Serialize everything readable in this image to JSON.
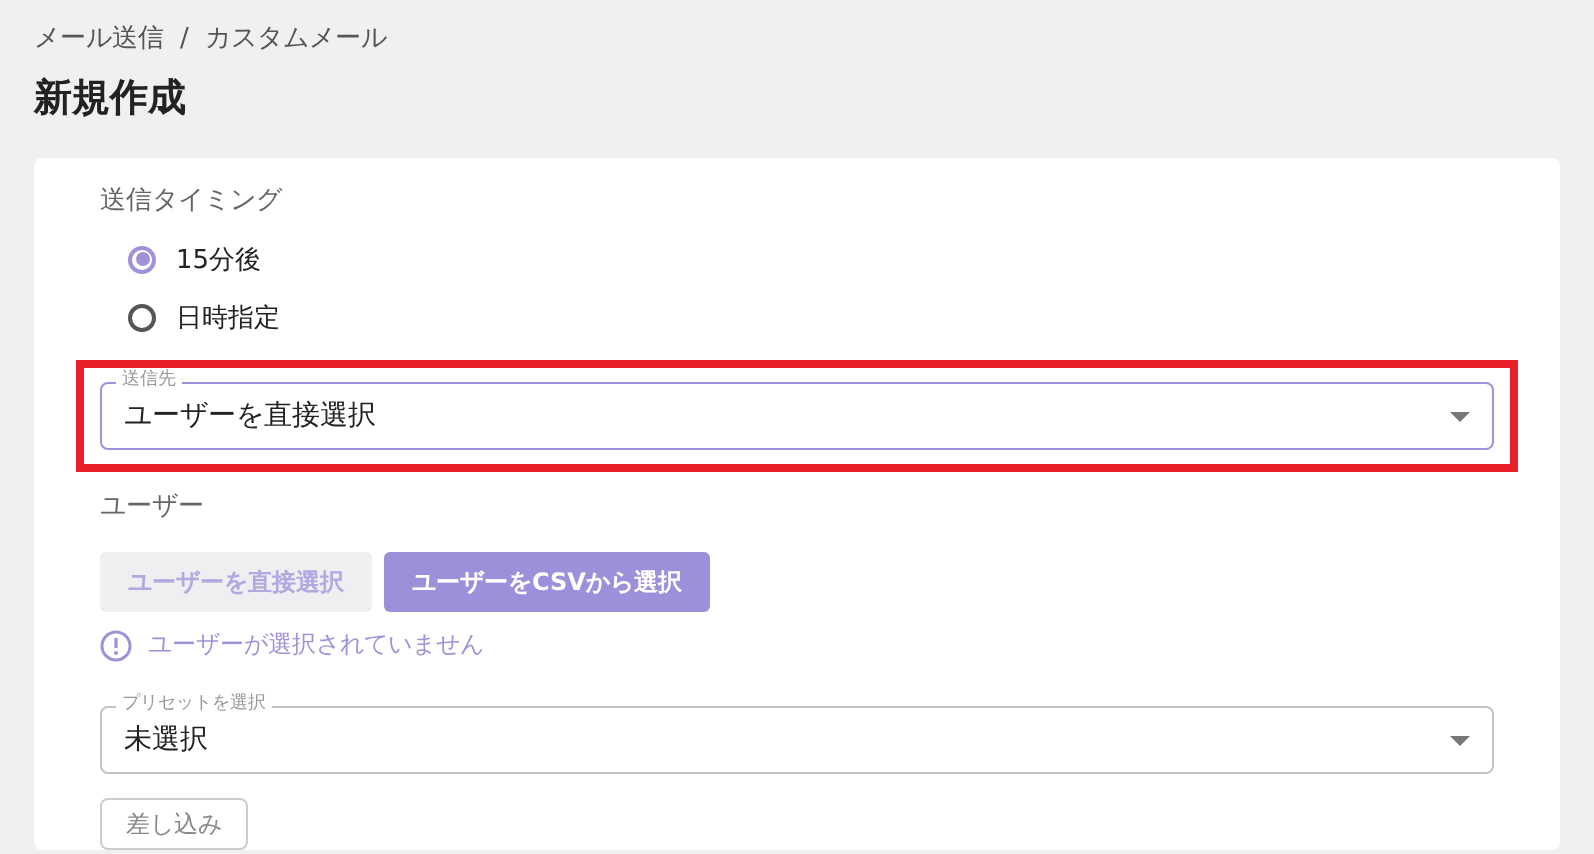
{
  "breadcrumb": [
    "メール送信",
    "カスタムメール"
  ],
  "breadcrumb_separator": "/",
  "title": "新規作成",
  "timing": {
    "label": "送信タイミング",
    "options": [
      {
        "label": "15分後",
        "selected": true
      },
      {
        "label": "日時指定",
        "selected": false
      }
    ]
  },
  "recipient": {
    "label": "送信先",
    "value": "ユーザーを直接選択",
    "highlighted": true,
    "focused": true
  },
  "users": {
    "label": "ユーザー",
    "buttons": [
      {
        "label": "ユーザーを直接選択",
        "selected": false
      },
      {
        "label": "ユーザーをCSVから選択",
        "selected": true
      }
    ],
    "error": "ユーザーが選択されていません"
  },
  "preset": {
    "label": "プリセットを選択",
    "value": "未選択",
    "focused": false
  },
  "insert_button": "差し込み"
}
